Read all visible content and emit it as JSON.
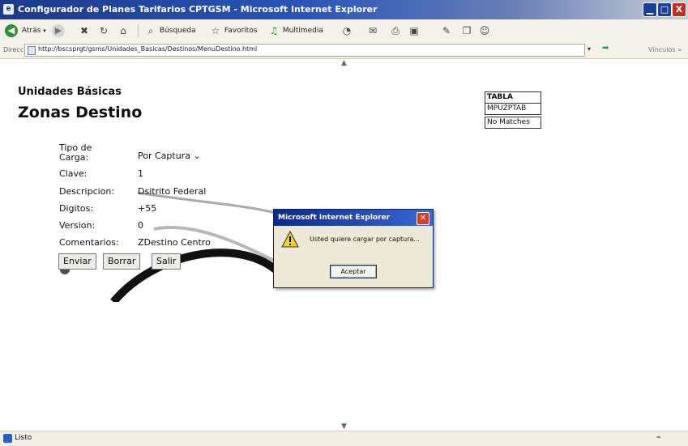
{
  "window": {
    "title": "Configurador de Planes Tarifarios CPTGSM - Microsoft Internet Explorer",
    "min_glyph": "▁",
    "max_glyph": "□",
    "close_glyph": "X"
  },
  "toolbar": {
    "back_label": "Atrás",
    "search_label": "Búsqueda",
    "favorites_label": "Favoritos",
    "multimedia_label": "Multimedia"
  },
  "addressbar": {
    "label": "Dirección",
    "url": "http://bscsprgt/gsms/Unidades_Basicas/Destinos/MenuDestino.html",
    "links_label": "Vínculos »"
  },
  "page": {
    "subtitle": "Unidades Básicas",
    "title": "Zonas Destino"
  },
  "form": {
    "tipo_label": "Tipo de Carga:",
    "tipo_value": "Por Captura ⌄",
    "clave_label": "Clave:",
    "clave_value": "1",
    "descripcion_label": "Descripcion:",
    "descripcion_value": "Dsitrito Federal",
    "digitos_label": "Digitos:",
    "digitos_value": "+55",
    "version_label": "Version:",
    "version_value": "0",
    "comentarios_label": "Comentarios:",
    "comentarios_value": "ZDestino Centro",
    "btn_enviar": "Enviar",
    "btn_borrar": "Borrar",
    "btn_salir": "Salir"
  },
  "side_table": {
    "title": "TABLA",
    "value": "MPUZPTAB",
    "status": "No Matches"
  },
  "dialog": {
    "title": "Microsoft Internet Explorer",
    "message": "Usted quiere cargar por captura...",
    "ok_label": "Aceptar",
    "close_glyph": "✕"
  },
  "statusbar": {
    "text": "Listo"
  },
  "colors": {
    "titlebar_start": "#1c3a8a",
    "dialog_title": "#0b2a8a",
    "toolbar_bg": "#f3f1ea"
  }
}
